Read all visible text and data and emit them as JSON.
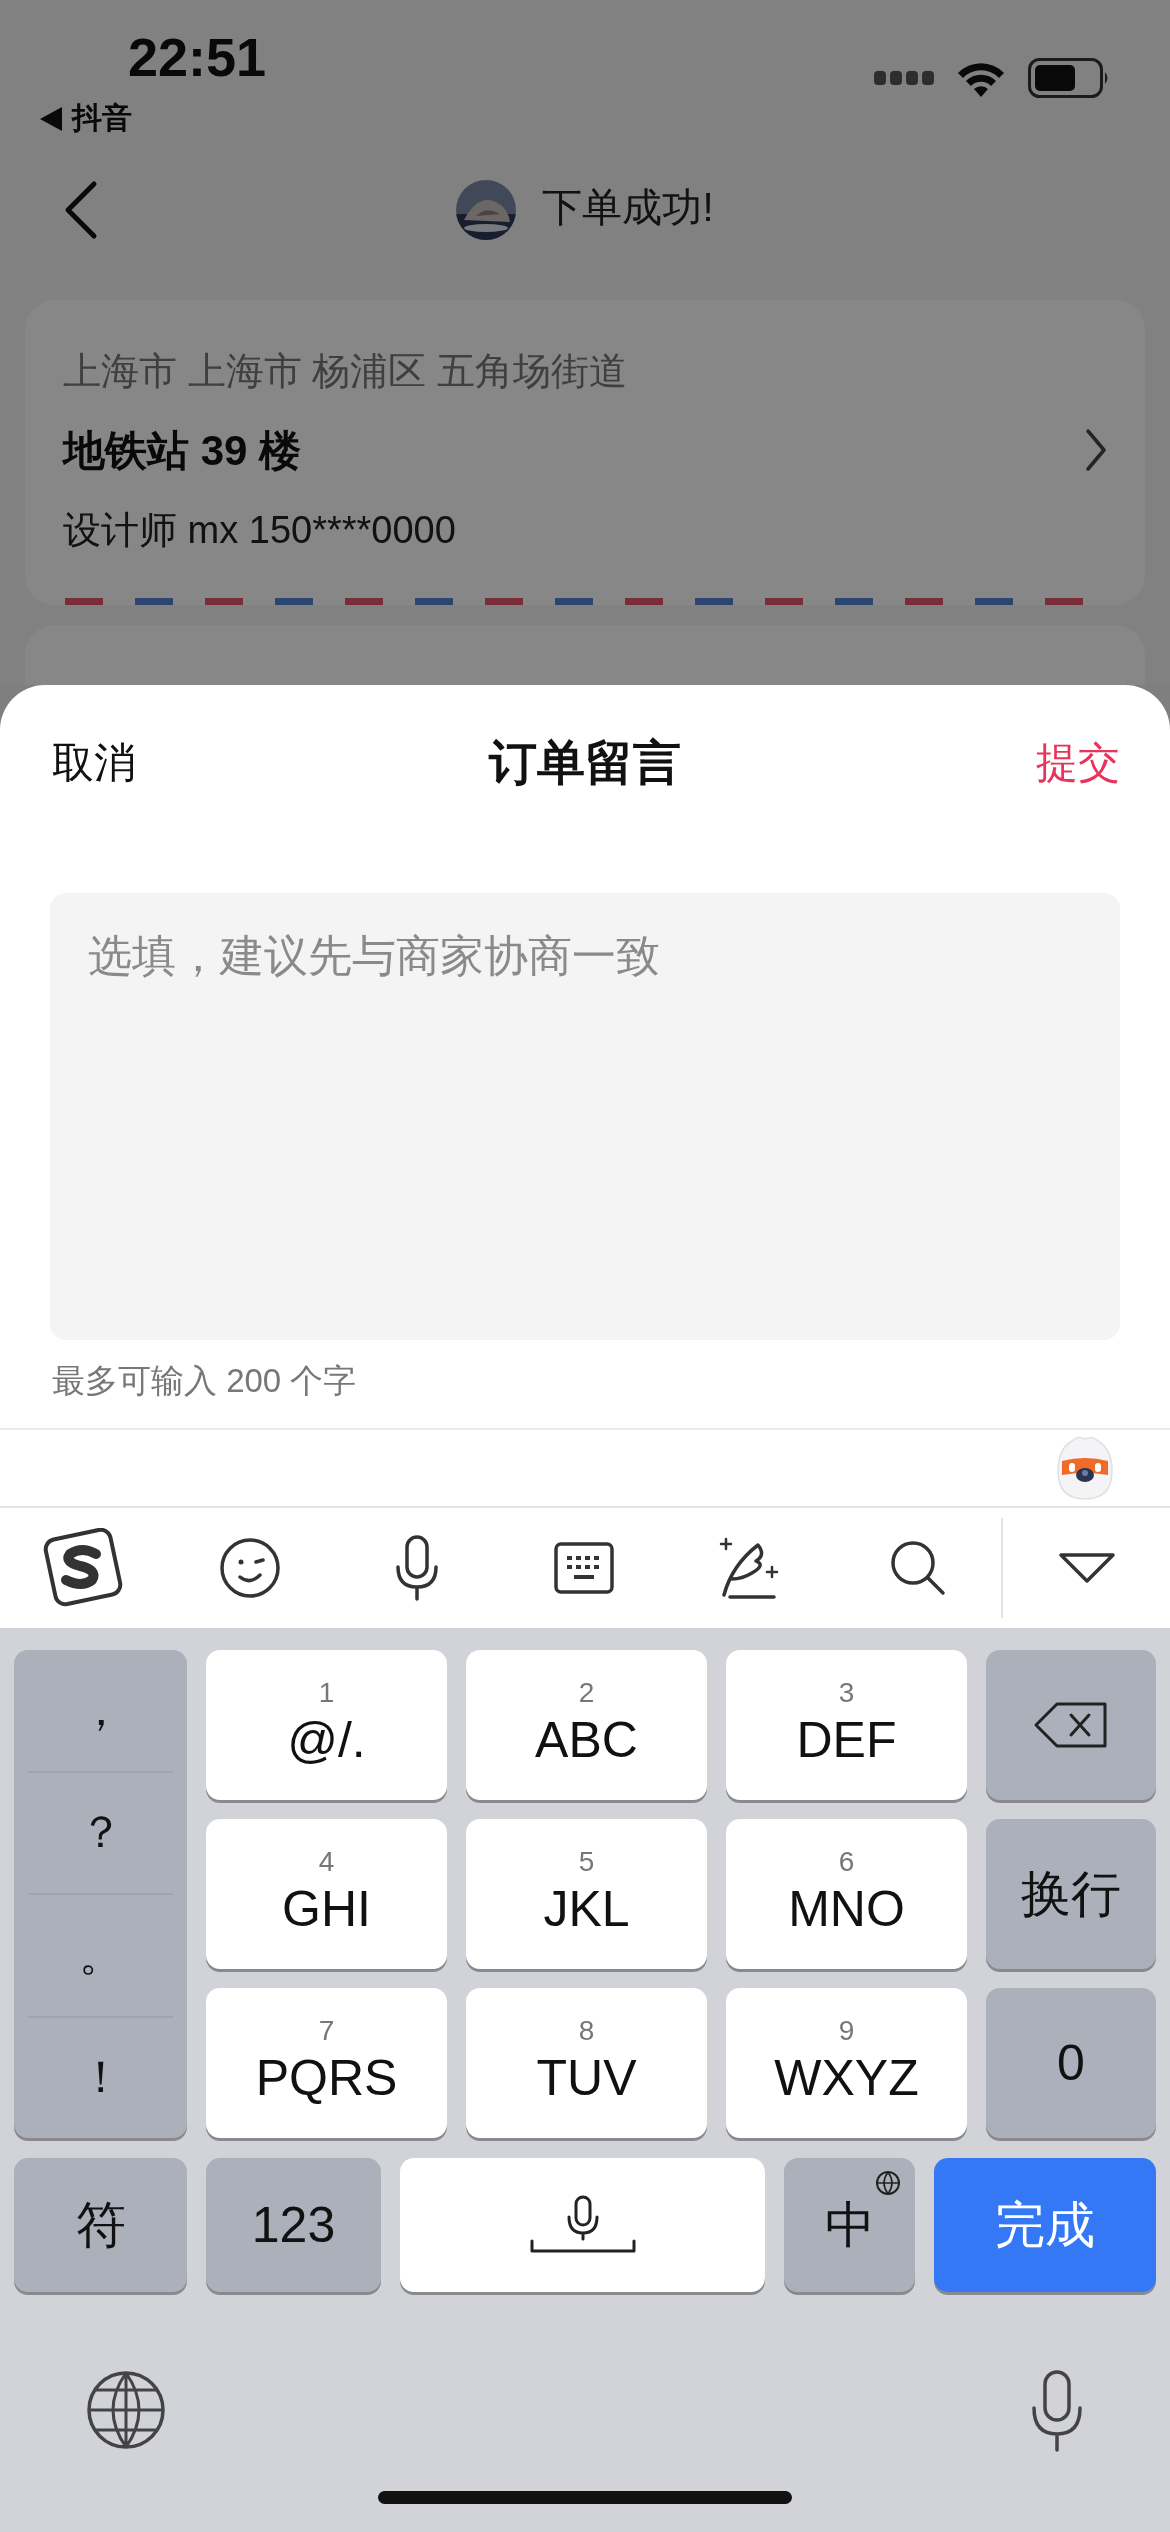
{
  "status_bar": {
    "time": "22:51",
    "back_app": "抖音"
  },
  "nav": {
    "title": "下单成功!"
  },
  "address": {
    "region": "上海市 上海市 杨浦区 五角场街道",
    "detail": "地铁站 39 楼",
    "contact": "设计师 mx 150****0000"
  },
  "sheet": {
    "cancel": "取消",
    "title": "订单留言",
    "submit": "提交",
    "placeholder": "选填，建议先与商家协商一致",
    "limit": "最多可输入 200 个字"
  },
  "keyboard": {
    "punctuation": [
      "，",
      "？",
      "。",
      "！"
    ],
    "keys": [
      {
        "digit": "1",
        "letters": "@/."
      },
      {
        "digit": "2",
        "letters": "ABC"
      },
      {
        "digit": "3",
        "letters": "DEF"
      },
      {
        "digit": "4",
        "letters": "GHI"
      },
      {
        "digit": "5",
        "letters": "JKL"
      },
      {
        "digit": "6",
        "letters": "MNO"
      },
      {
        "digit": "7",
        "letters": "PQRS"
      },
      {
        "digit": "8",
        "letters": "TUV"
      },
      {
        "digit": "9",
        "letters": "WXYZ"
      }
    ],
    "newline": "换行",
    "zero": "0",
    "symbols": "符",
    "numbers": "123",
    "language": "中",
    "done": "完成"
  }
}
